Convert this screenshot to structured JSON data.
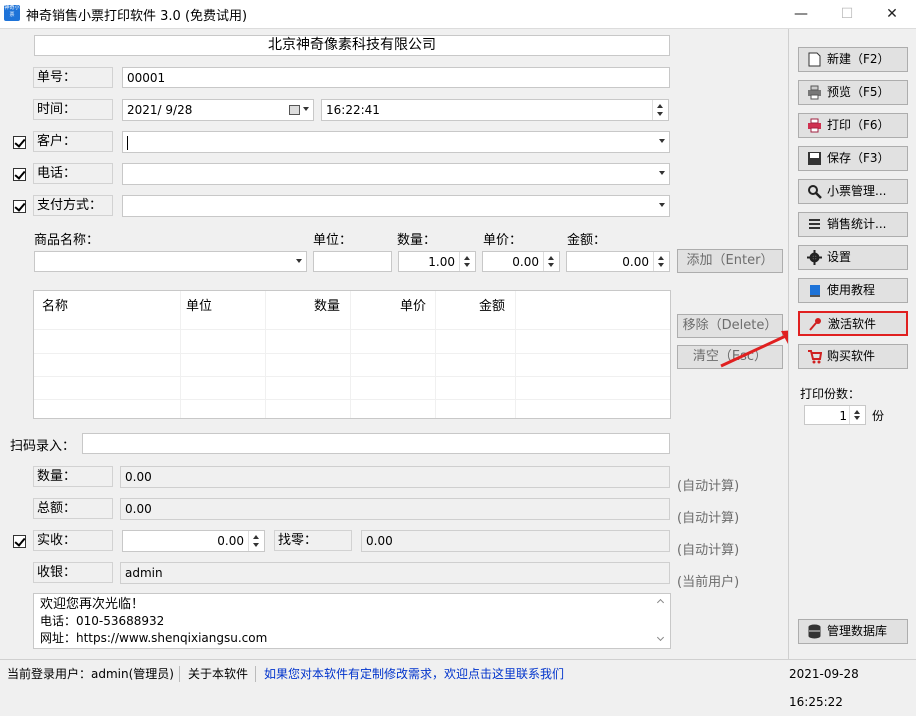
{
  "window": {
    "title": "神奇销售小票打印软件 3.0 (免费试用)",
    "icon_text": "神奇小票",
    "min_glyph": "—",
    "max_glyph": "☐",
    "close_glyph": "✕"
  },
  "header": {
    "company": "北京神奇像素科技有限公司"
  },
  "form": {
    "order_no_label": "单号：",
    "order_no": "00001",
    "time_label": "时间：",
    "date": "2021/  9/28",
    "time": "16:22:41",
    "customer_label": "客户：",
    "customer": "",
    "phone_label": "电话：",
    "phone": "",
    "payment_label": "支付方式：",
    "payment": ""
  },
  "product": {
    "name_label": "商品名称：",
    "unit_label": "单位：",
    "qty_label": "数量：",
    "price_label": "单价：",
    "amount_label": "金额：",
    "qty": "1.00",
    "price": "0.00",
    "amount": "0.00",
    "add_button": "添加（Enter）",
    "remove_button": "移除（Delete）",
    "clear_button": "清空（Esc）"
  },
  "table": {
    "columns": [
      "名称",
      "单位",
      "数量",
      "单价",
      "金额"
    ]
  },
  "scan": {
    "label": "扫码录入：",
    "value": ""
  },
  "totals": {
    "qty_label": "数量：",
    "qty": "0.00",
    "qty_hint": "(自动计算)",
    "total_label": "总额：",
    "total": "0.00",
    "total_hint": "(自动计算)",
    "paid_label": "实收：",
    "paid": "0.00",
    "change_label": "找零：",
    "change": "0.00",
    "change_hint": "(自动计算)",
    "cashier_label": "收银：",
    "cashier": "admin",
    "cashier_hint": "(当前用户)"
  },
  "footer_text": {
    "line1": "欢迎您再次光临！",
    "line2": "电话：010-53688932",
    "line3": "网址：https://www.shenqixiangsu.com"
  },
  "sidebar": {
    "new": "新建（F2）",
    "preview": "预览（F5）",
    "print": "打印（F6）",
    "save": "保存（F3）",
    "ticket_mgmt": "小票管理...",
    "sales_stats": "销售统计...",
    "settings": "设置",
    "tutorial": "使用教程",
    "activate": "激活软件",
    "buy": "购买软件",
    "copies_label": "打印份数：",
    "copies": "1",
    "copies_unit": "份",
    "db_mgmt": "管理数据库"
  },
  "status": {
    "user": "当前登录用户：admin(管理员)",
    "about": "关于本软件",
    "custom": "如果您对本软件有定制修改需求，欢迎点击这里联系我们",
    "datetime": "2021-09-28 16:25:22"
  },
  "colors": {
    "accent": "#1e73d8",
    "highlight": "#e02020",
    "link": "#0033cc"
  }
}
